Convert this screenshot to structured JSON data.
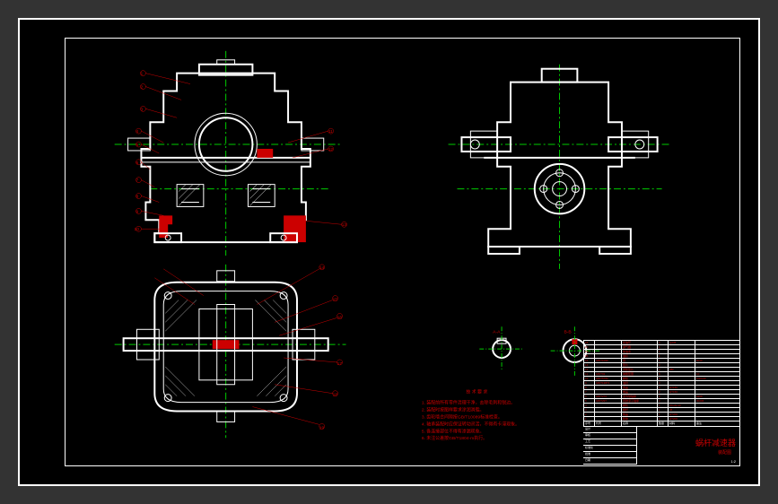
{
  "drawing": {
    "views": [
      "front-section",
      "top-section",
      "side-elevation",
      "detail-a",
      "detail-b"
    ],
    "balloon_numbers": [
      "1",
      "2",
      "3",
      "4",
      "5",
      "6",
      "7",
      "8",
      "9",
      "10",
      "11",
      "12",
      "13",
      "14",
      "15",
      "16",
      "17",
      "18",
      "19",
      "20"
    ],
    "section_label_a": "A-A",
    "section_label_b": "B-B"
  },
  "tech_notes": {
    "heading": "技 术 要 求",
    "lines": [
      "1. 装配前所有零件清理干净，去除毛刺和锐边。",
      "2. 装配时按图样要求涂润滑脂。",
      "3. 齿轮啮合间隙按GB/T10089标准检查。",
      "4. 轴承装配时应保证转动灵活，不得有卡滞现象。",
      "5. 各连接部位不得有渗漏现象。",
      "6. 未注公差按GB/T1804-m执行。"
    ]
  },
  "parts_list": {
    "headers": [
      "序号",
      "代号",
      "名称",
      "数量",
      "材料",
      "备注"
    ],
    "rows": [
      {
        "no": "1",
        "code": "",
        "name": "箱体",
        "qty": "1",
        "mat": "HT200",
        "note": ""
      },
      {
        "no": "2",
        "code": "",
        "name": "箱盖",
        "qty": "1",
        "mat": "HT200",
        "note": ""
      },
      {
        "no": "3",
        "code": "",
        "name": "蜗杆",
        "qty": "1",
        "mat": "45",
        "note": ""
      },
      {
        "no": "4",
        "code": "",
        "name": "蜗轮",
        "qty": "1",
        "mat": "ZCuSn10",
        "note": ""
      },
      {
        "no": "5",
        "code": "GB/T297",
        "name": "圆锥滚子轴承",
        "qty": "2",
        "mat": "",
        "note": "30206"
      },
      {
        "no": "6",
        "code": "GB/T276",
        "name": "深沟球轴承",
        "qty": "2",
        "mat": "",
        "note": "6208"
      },
      {
        "no": "7",
        "code": "",
        "name": "端盖",
        "qty": "2",
        "mat": "HT150",
        "note": ""
      },
      {
        "no": "8",
        "code": "",
        "name": "透盖",
        "qty": "2",
        "mat": "HT150",
        "note": ""
      },
      {
        "no": "9",
        "code": "GB/T13871",
        "name": "油封",
        "qty": "2",
        "mat": "",
        "note": ""
      },
      {
        "no": "10",
        "code": "GB/T5782",
        "name": "螺栓",
        "qty": "6",
        "mat": "",
        "note": "M10x40"
      },
      {
        "no": "11",
        "code": "GB/T93",
        "name": "弹簧垫圈",
        "qty": "6",
        "mat": "",
        "note": "10"
      },
      {
        "no": "12",
        "code": "",
        "name": "调整垫片",
        "qty": "2",
        "mat": "08F",
        "note": ""
      },
      {
        "no": "13",
        "code": "",
        "name": "垫片",
        "qty": "2",
        "mat": "",
        "note": ""
      },
      {
        "no": "14",
        "code": "GB/T1096",
        "name": "键",
        "qty": "1",
        "mat": "",
        "note": "8x40"
      },
      {
        "no": "15",
        "code": "",
        "name": "油标",
        "qty": "1",
        "mat": "",
        "note": ""
      },
      {
        "no": "16",
        "code": "",
        "name": "放油塞",
        "qty": "1",
        "mat": "",
        "note": ""
      },
      {
        "no": "17",
        "code": "",
        "name": "通气器",
        "qty": "1",
        "mat": "",
        "note": ""
      },
      {
        "no": "18",
        "code": "",
        "name": "挡油环",
        "qty": "2",
        "mat": "Q235",
        "note": ""
      }
    ]
  },
  "title_block": {
    "title": "蜗杆减速器",
    "subtitle": "装配图",
    "scale": "1:2",
    "sheet": "第1张 共1张",
    "fields": [
      "设计",
      "审核",
      "工艺",
      "标准化",
      "批准",
      "日期"
    ]
  }
}
